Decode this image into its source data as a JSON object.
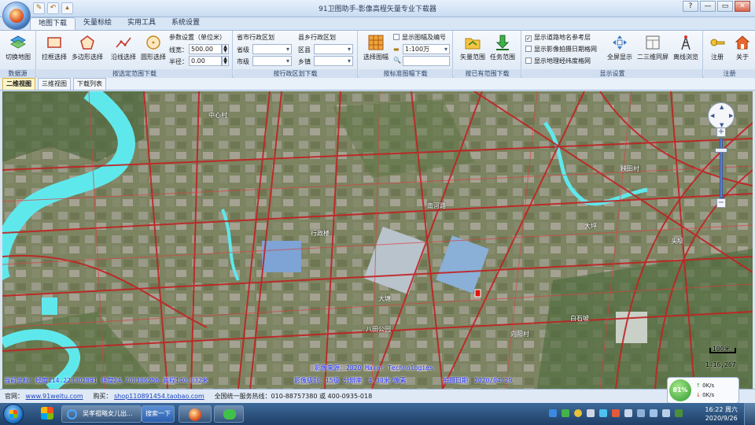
{
  "window": {
    "title": "91卫图助手-影像高程矢量专业下载器",
    "controls": [
      "?",
      "—",
      "▭",
      "✕"
    ],
    "quick_access": [
      "✎",
      "↶",
      "▴"
    ]
  },
  "tabs": [
    "地图下载",
    "矢量标绘",
    "实用工具",
    "系统设置"
  ],
  "active_tab": "地图下载",
  "ribbon": {
    "data_source": {
      "group_label": "数据源",
      "switch_map": "切换地图"
    },
    "range_select": {
      "group_label": "按选定范围下载",
      "rect_select": "拉框选择",
      "polygon_select": "多边形选择",
      "line_select": "沿线选择",
      "circle_select": "圆形选择",
      "param_title": "参数设置（单位米）",
      "line_width_label": "线宽：",
      "line_width_value": "500.00",
      "radius_label": "半径：",
      "radius_value": "0.00"
    },
    "admin_city": {
      "group_label": "按行政区划下载",
      "city_title": "省市行政区划",
      "province_label": "省级",
      "city_label": "市级",
      "county_title": "县乡行政区划",
      "county_label": "区县",
      "town_label": "乡镇"
    },
    "sheet": {
      "group_label": "按标准图幅下载",
      "select_sheet": "选择图幅",
      "show_sheet_label": "显示图幅及编号",
      "scale_value": "1:100万"
    },
    "existing": {
      "group_label": "按已有范围下载",
      "vector_range": "矢量范围",
      "task_range": "任务范围"
    },
    "display": {
      "group_label": "显示设置",
      "show_road_names": "显示道路地名参考层",
      "show_capture_date": "显示影像拍摄日期格网",
      "show_graticule": "显示地理经纬度格网",
      "fullscreen": "全屏显示",
      "dual_screen": "二三维同屏",
      "offline": "离线浏览"
    },
    "register": {
      "group_label": "注册",
      "register": "注册",
      "about": "关于"
    }
  },
  "view_tabs": [
    "二维视图",
    "三维视图",
    "下载列表"
  ],
  "map": {
    "coord_text": "当前坐标：经度114.223302891 纬度24.708106256 高程140.032米",
    "source_text": "影像来源：2020 Maxar Technologies",
    "level_text": "影像级别：15级  分辨率：4.30米/像素",
    "date_text": "拍摄日期：2020/04/29",
    "scale_bar": "100米",
    "scale_ratio": "1:16,267",
    "labels": [
      "中心村",
      "行政楼",
      "大塘",
      "秧田村",
      "大坪",
      "头坝",
      "白石坡",
      "向阳村",
      "八田公园",
      "南河路"
    ],
    "colors": {
      "water": "#5fe8ec",
      "road": "#c02222",
      "vegetation": "#6e7a55"
    }
  },
  "status": {
    "site_label": "官网：",
    "site_url": "www.91weitu.com",
    "shop_label": "购买：",
    "shop_url": "shop110891454.taobao.com",
    "hotline": "全国统一服务热线：010-88757380 或 400-0935-018"
  },
  "speed": {
    "percent": "81%",
    "up": "0K/s",
    "down": "0K/s"
  },
  "taskbar": {
    "browser_tab": "吴孝祖略女儿出...",
    "search_button": "搜索一下",
    "time": "16:22 周六",
    "date": "2020/9/26"
  }
}
